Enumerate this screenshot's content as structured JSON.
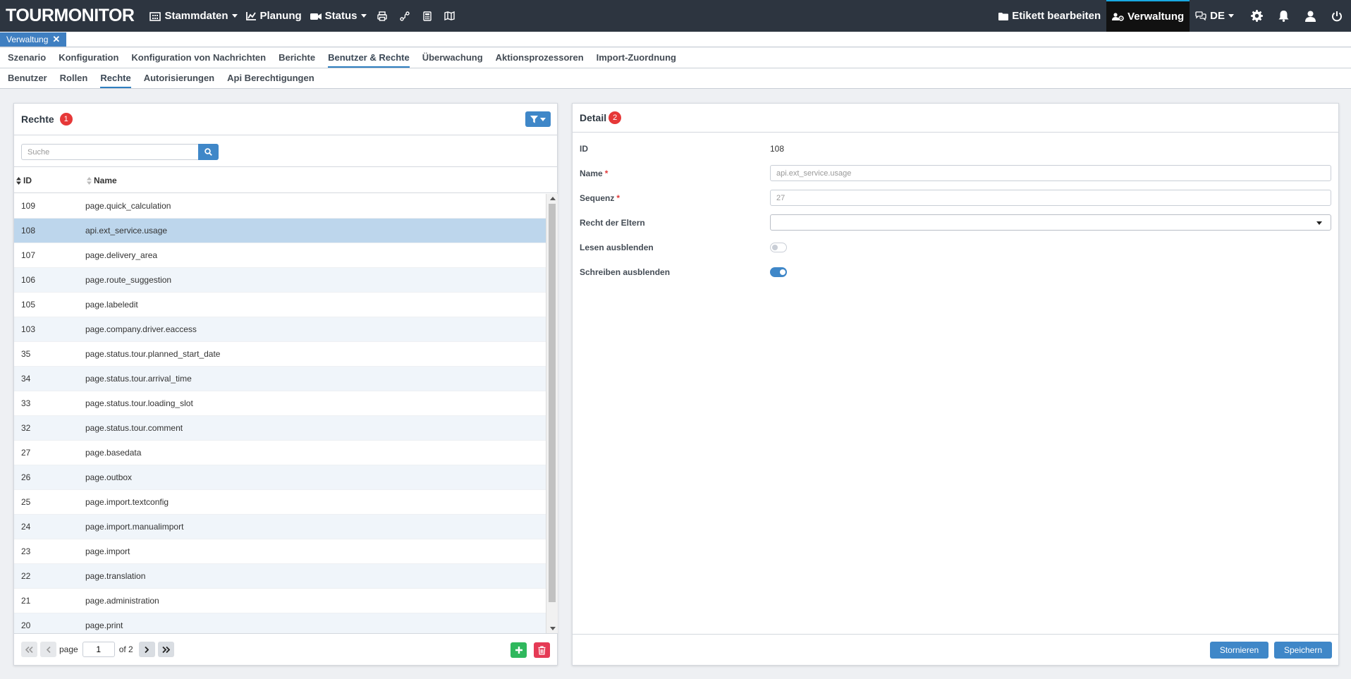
{
  "navbar": {
    "logo": "TOURMONITOR",
    "items": [
      {
        "label": "Stammdaten",
        "icon": "building-icon",
        "dropdown": true
      },
      {
        "label": "Planung",
        "icon": "chart-icon",
        "dropdown": false
      },
      {
        "label": "Status",
        "icon": "video-icon",
        "dropdown": true
      }
    ],
    "icons": [
      "print-icon",
      "route-icon",
      "calculator-icon",
      "map-icon"
    ],
    "right": {
      "label_edit": "Etikett bearbeiten",
      "admin": "Verwaltung",
      "language": "DE"
    }
  },
  "open_tab": {
    "label": "Verwaltung",
    "close": "✕"
  },
  "menu1": [
    "Szenario",
    "Konfiguration",
    "Konfiguration von Nachrichten",
    "Berichte",
    "Benutzer & Rechte",
    "Überwachung",
    "Aktionsprozessoren",
    "Import-Zuordnung"
  ],
  "menu1_active": "Benutzer & Rechte",
  "menu2": [
    "Benutzer",
    "Rollen",
    "Rechte",
    "Autorisierungen",
    "Api Berechtigungen"
  ],
  "menu2_active": "Rechte",
  "rights_panel": {
    "title": "Rechte",
    "badge": "1",
    "search_placeholder": "Suche",
    "columns": {
      "id": "ID",
      "name": "Name"
    },
    "rows": [
      {
        "id": "109",
        "name": "page.quick_calculation"
      },
      {
        "id": "108",
        "name": "api.ext_service.usage",
        "selected": true
      },
      {
        "id": "107",
        "name": "page.delivery_area"
      },
      {
        "id": "106",
        "name": "page.route_suggestion"
      },
      {
        "id": "105",
        "name": "page.labeledit"
      },
      {
        "id": "103",
        "name": "page.company.driver.eaccess"
      },
      {
        "id": "35",
        "name": "page.status.tour.planned_start_date"
      },
      {
        "id": "34",
        "name": "page.status.tour.arrival_time"
      },
      {
        "id": "33",
        "name": "page.status.tour.loading_slot"
      },
      {
        "id": "32",
        "name": "page.status.tour.comment"
      },
      {
        "id": "27",
        "name": "page.basedata"
      },
      {
        "id": "26",
        "name": "page.outbox"
      },
      {
        "id": "25",
        "name": "page.import.textconfig"
      },
      {
        "id": "24",
        "name": "page.import.manualimport"
      },
      {
        "id": "23",
        "name": "page.import"
      },
      {
        "id": "22",
        "name": "page.translation"
      },
      {
        "id": "21",
        "name": "page.administration"
      },
      {
        "id": "20",
        "name": "page.print"
      }
    ],
    "pager": {
      "page_label": "page",
      "page_value": "1",
      "of_label": "of 2"
    }
  },
  "detail_panel": {
    "title": "Detail",
    "badge": "2",
    "fields": {
      "id_label": "ID",
      "id_value": "108",
      "name_label": "Name",
      "name_value": "api.ext_service.usage",
      "seq_label": "Sequenz",
      "seq_value": "27",
      "parent_label": "Recht der Eltern",
      "hide_read_label": "Lesen ausblenden",
      "hide_read_value": false,
      "hide_write_label": "Schreiben ausblenden",
      "hide_write_value": true,
      "required_mark": "*"
    },
    "buttons": {
      "cancel": "Stornieren",
      "save": "Speichern"
    }
  },
  "colors": {
    "navbar_bg": "#2d3540",
    "accent": "#3f87c8",
    "selected_row": "#bdd6ec",
    "badge": "#e63838",
    "add": "#2fb85d",
    "delete": "#e53a55"
  }
}
